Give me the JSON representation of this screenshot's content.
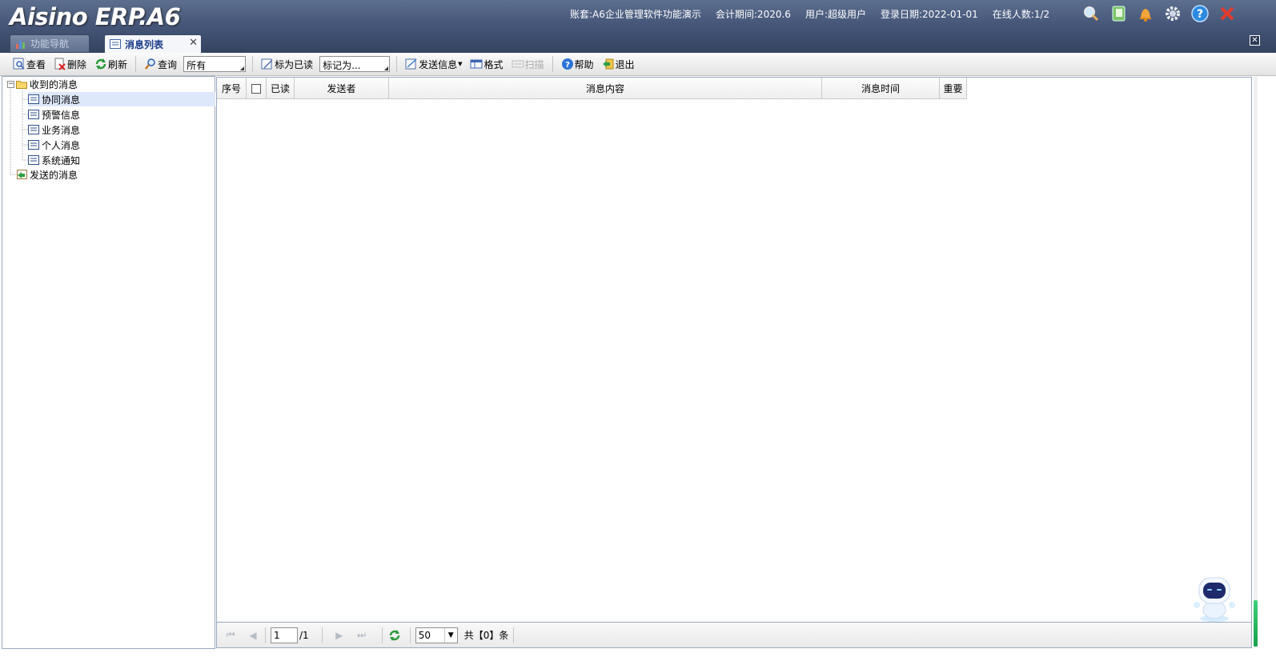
{
  "app": {
    "logo": "Aisino ERP.A6",
    "account_label": "账套:A6企业管理软件功能演示",
    "period_label": "会计期间:2020.6",
    "user_label": "用户:超级用户",
    "login_date_label": "登录日期:2022-01-01",
    "online_label": "在线人数:1/2"
  },
  "header_icons": [
    "search-icon",
    "notebook-icon",
    "bell-icon",
    "gear-icon",
    "help-icon",
    "close-icon"
  ],
  "tabs": [
    {
      "label": "功能导航",
      "active": false
    },
    {
      "label": "消息列表",
      "active": true
    }
  ],
  "toolbar": {
    "view": "查看",
    "delete": "删除",
    "refresh": "刷新",
    "query": "查询",
    "filter_value": "所有",
    "mark_read": "标为已读",
    "mark_as_value": "标记为...",
    "send_message": "发送信息",
    "format": "格式",
    "scan": "扫描",
    "help": "帮助",
    "exit": "退出"
  },
  "tree": {
    "received": "收到的消息",
    "children": [
      "协同消息",
      "预警信息",
      "业务消息",
      "个人消息",
      "系统通知"
    ],
    "sent": "发送的消息",
    "selected": "协同消息"
  },
  "grid": {
    "columns": [
      "序号",
      "已读",
      "发送者",
      "消息内容",
      "消息时间",
      "重要"
    ],
    "rows": []
  },
  "pager": {
    "page": "1",
    "total_pages": "/1",
    "page_size": "50",
    "total_text": "共【0】条"
  },
  "colors": {
    "header_bg": "#46577a",
    "selected_row": "#dde8fb",
    "border": "#9aa8bf",
    "active_tab_text": "#1a3a88"
  }
}
